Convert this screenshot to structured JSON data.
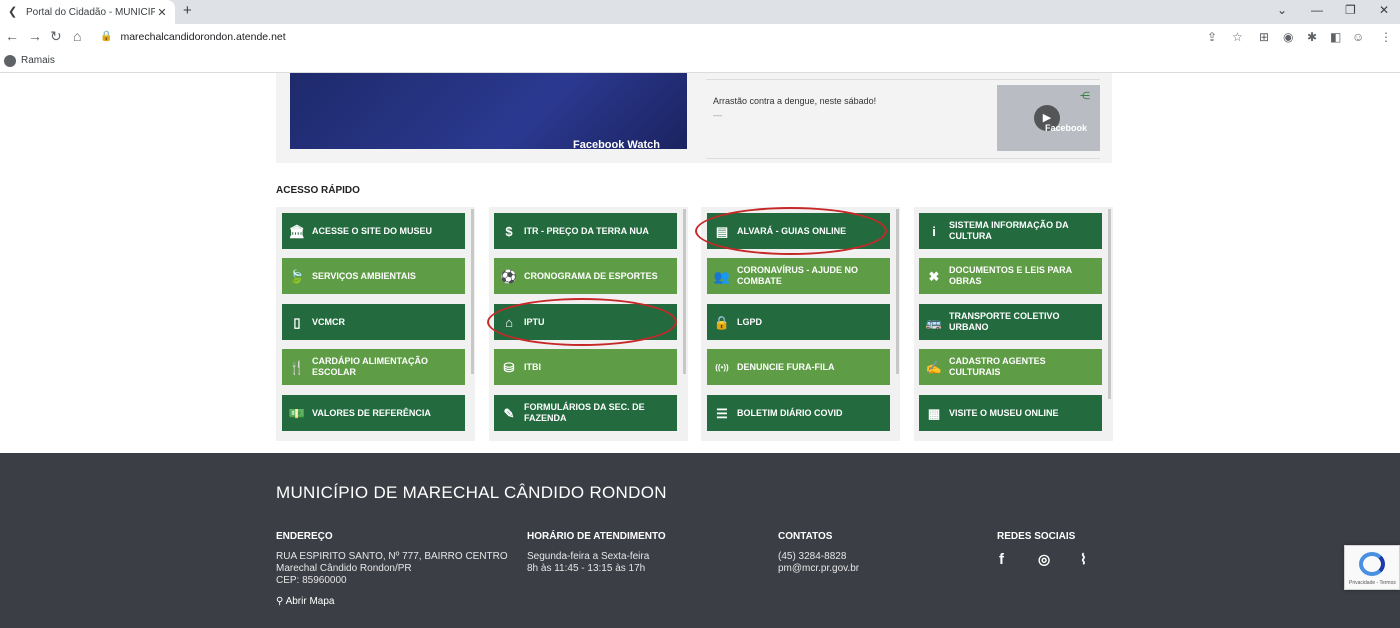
{
  "browser": {
    "tab_title": "Portal do Cidadão - MUNICÍPIO DE",
    "url": "marechalcandidorondon.atende.net",
    "bookmark": "Ramais"
  },
  "video_section": {
    "facebook_watch": "Facebook Watch",
    "video_title": "Arrastão contra a dengue, neste sábado!",
    "video_meta": "—",
    "thumb_label": "Facebook"
  },
  "quick_access": {
    "title": "ACESSO RÁPIDO",
    "columns": [
      [
        {
          "label": "ACESSE O SITE DO MUSEU",
          "icon": "museum-icon",
          "glyph": "🏛"
        },
        {
          "label": "SERVIÇOS AMBIENTAIS",
          "icon": "leaf-icon",
          "glyph": "🍃"
        },
        {
          "label": "VCMCR",
          "icon": "mobile-icon",
          "glyph": "▯"
        },
        {
          "label": "CARDÁPIO ALIMENTAÇÃO ESCOLAR",
          "icon": "utensils-icon",
          "glyph": "🍴"
        },
        {
          "label": "VALORES DE REFERÊNCIA",
          "icon": "money-icon",
          "glyph": "💵"
        }
      ],
      [
        {
          "label": "ITR - PREÇO DA TERRA NUA",
          "icon": "dollar-icon",
          "glyph": "$"
        },
        {
          "label": "CRONOGRAMA DE ESPORTES",
          "icon": "ball-icon",
          "glyph": "⚽"
        },
        {
          "label": "IPTU",
          "icon": "home-icon",
          "glyph": "⌂"
        },
        {
          "label": "ITBI",
          "icon": "coins-icon",
          "glyph": "⛁"
        },
        {
          "label": "FORMULÁRIOS DA SEC. DE FAZENDA",
          "icon": "pencil-icon",
          "glyph": "✎"
        }
      ],
      [
        {
          "label": "ALVARÁ - GUIAS ONLINE",
          "icon": "document-icon",
          "glyph": "▤"
        },
        {
          "label": "CORONAVÍRUS - AJUDE NO COMBATE",
          "icon": "users-icon",
          "glyph": "👥"
        },
        {
          "label": "LGPD",
          "icon": "lock-icon",
          "glyph": "🔒"
        },
        {
          "label": "DENUNCIE FURA-FILA",
          "icon": "broadcast-icon",
          "glyph": "((•))"
        },
        {
          "label": "BOLETIM DIÁRIO COVID",
          "icon": "list-icon",
          "glyph": "☰"
        }
      ],
      [
        {
          "label": "SISTEMA INFORMAÇÃO DA CULTURA",
          "icon": "info-icon",
          "glyph": "i"
        },
        {
          "label": "DOCUMENTOS E LEIS PARA OBRAS",
          "icon": "tools-icon",
          "glyph": "✖"
        },
        {
          "label": "TRANSPORTE COLETIVO URBANO",
          "icon": "bus-icon",
          "glyph": "🚌"
        },
        {
          "label": "CADASTRO AGENTES CULTURAIS",
          "icon": "signature-icon",
          "glyph": "✍"
        },
        {
          "label": "VISITE O MUSEU ONLINE",
          "icon": "building-icon",
          "glyph": "▦"
        }
      ]
    ]
  },
  "footer": {
    "title": "MUNICÍPIO DE MARECHAL CÂNDIDO RONDON",
    "address_heading": "ENDEREÇO",
    "address_line1": "RUA ESPIRITO SANTO, Nº 777, BAIRRO CENTRO",
    "address_line2": "Marechal Cândido Rondon/PR",
    "address_line3": "CEP: 85960000",
    "map_link": "Abrir Mapa",
    "hours_heading": "HORÁRIO DE ATENDIMENTO",
    "hours_line1": "Segunda-feira a Sexta-feira",
    "hours_line2": "8h às 11:45 - 13:15 às 17h",
    "contacts_heading": "CONTATOS",
    "phone": "(45) 3284-8828",
    "email": "pm@mcr.pr.gov.br",
    "social_heading": "REDES SOCIAIS"
  },
  "recaptcha": {
    "text": "Privacidade - Termos"
  }
}
